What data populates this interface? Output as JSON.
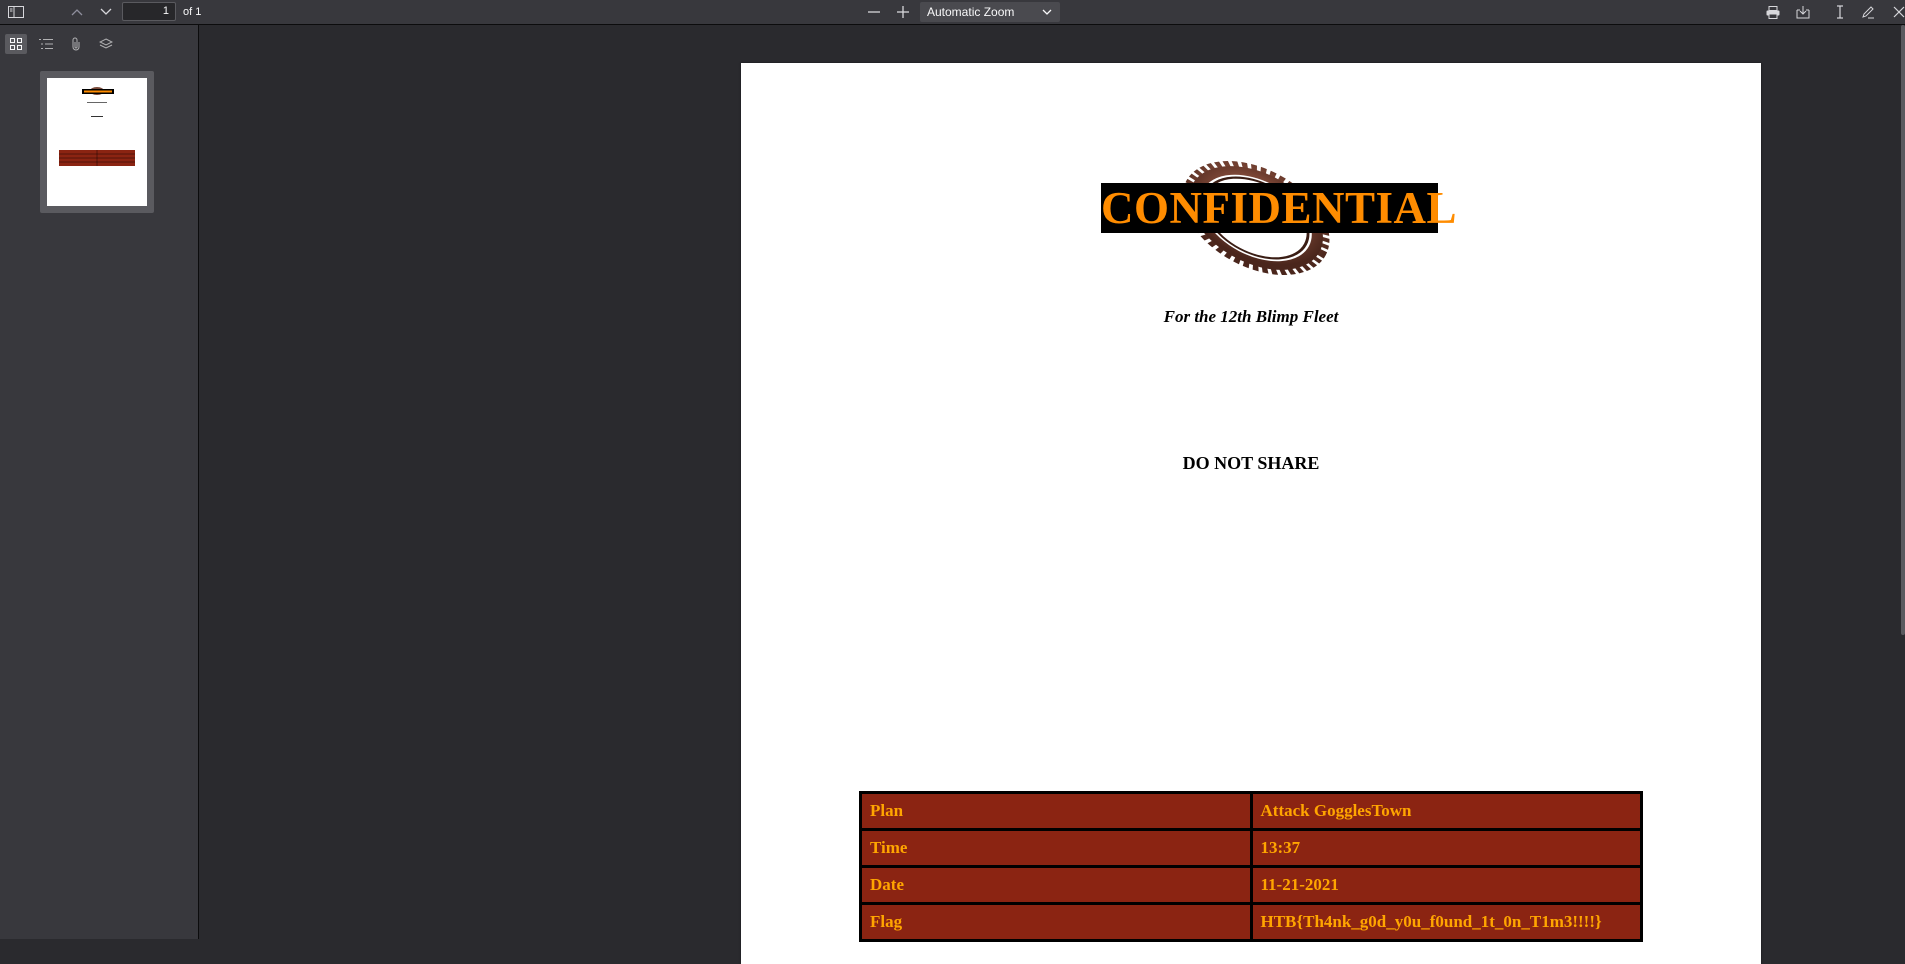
{
  "toolbar": {
    "page_number": "1",
    "page_count_label": "of 1",
    "zoom_label": "Automatic Zoom"
  },
  "document": {
    "title": "CONFIDENTIAL",
    "subtitle": "For the 12th Blimp Fleet",
    "notice": "DO NOT SHARE",
    "table": [
      {
        "key": "Plan",
        "value": "Attack GogglesTown"
      },
      {
        "key": "Time",
        "value": "13:37"
      },
      {
        "key": "Date",
        "value": "11-21-2021"
      },
      {
        "key": "Flag",
        "value": "HTB{Th4nk_g0d_y0u_f0und_1t_0n_T1m3!!!!}"
      }
    ]
  },
  "colors": {
    "title_text": "#ff8c00",
    "table_bg": "#8b2412",
    "table_text": "#ffa500"
  }
}
